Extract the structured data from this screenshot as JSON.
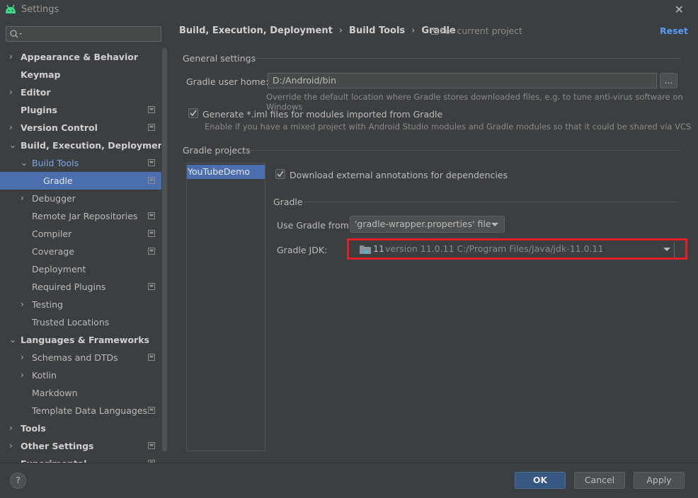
{
  "window": {
    "title": "Settings",
    "close_glyph": "✕",
    "app_icon": "android-icon"
  },
  "search": {
    "placeholder": "",
    "icon": "search-icon"
  },
  "sidebar": {
    "items": [
      {
        "label": "Appearance & Behavior",
        "level": 0,
        "chevron": "›",
        "bold": true,
        "project": false
      },
      {
        "label": "Keymap",
        "level": 0,
        "chevron": "",
        "bold": true,
        "project": false
      },
      {
        "label": "Editor",
        "level": 0,
        "chevron": "›",
        "bold": true,
        "project": false
      },
      {
        "label": "Plugins",
        "level": 0,
        "chevron": "",
        "bold": true,
        "project": true
      },
      {
        "label": "Version Control",
        "level": 0,
        "chevron": "›",
        "bold": true,
        "project": true
      },
      {
        "label": "Build, Execution, Deployment",
        "level": 0,
        "chevron": "⌄",
        "bold": true,
        "project": false
      },
      {
        "label": "Build Tools",
        "level": 1,
        "chevron": "⌄",
        "bold": false,
        "project": true
      },
      {
        "label": "Gradle",
        "level": 2,
        "chevron": "",
        "bold": false,
        "project": true
      },
      {
        "label": "Debugger",
        "level": 1,
        "chevron": "›",
        "bold": false,
        "project": false
      },
      {
        "label": "Remote Jar Repositories",
        "level": 1,
        "chevron": "",
        "bold": false,
        "project": true
      },
      {
        "label": "Compiler",
        "level": 1,
        "chevron": "",
        "bold": false,
        "project": true
      },
      {
        "label": "Coverage",
        "level": 1,
        "chevron": "",
        "bold": false,
        "project": true
      },
      {
        "label": "Deployment",
        "level": 1,
        "chevron": "",
        "bold": false,
        "project": false
      },
      {
        "label": "Required Plugins",
        "level": 1,
        "chevron": "",
        "bold": false,
        "project": true
      },
      {
        "label": "Testing",
        "level": 1,
        "chevron": "›",
        "bold": false,
        "project": false
      },
      {
        "label": "Trusted Locations",
        "level": 1,
        "chevron": "",
        "bold": false,
        "project": false
      },
      {
        "label": "Languages & Frameworks",
        "level": 0,
        "chevron": "⌄",
        "bold": true,
        "project": false
      },
      {
        "label": "Schemas and DTDs",
        "level": 1,
        "chevron": "›",
        "bold": false,
        "project": true
      },
      {
        "label": "Kotlin",
        "level": 1,
        "chevron": "›",
        "bold": false,
        "project": false
      },
      {
        "label": "Markdown",
        "level": 1,
        "chevron": "",
        "bold": false,
        "project": false
      },
      {
        "label": "Template Data Languages",
        "level": 1,
        "chevron": "",
        "bold": false,
        "project": true
      },
      {
        "label": "Tools",
        "level": 0,
        "chevron": "›",
        "bold": true,
        "project": false
      },
      {
        "label": "Other Settings",
        "level": 0,
        "chevron": "›",
        "bold": true,
        "project": true
      },
      {
        "label": "Experimental",
        "level": 0,
        "chevron": "",
        "bold": true,
        "project": true
      }
    ],
    "selected_index": 7
  },
  "breadcrumb": {
    "parts": [
      "Build, Execution, Deployment",
      "Build Tools",
      "Gradle"
    ],
    "separator": "›",
    "for_project": "For current project",
    "reset": "Reset"
  },
  "general": {
    "section_title": "General settings",
    "gradle_home_label": "Gradle user home:",
    "gradle_home_value": "D:/Android/bin",
    "browse_label": "...",
    "gradle_home_hint": "Override the default location where Gradle stores downloaded files, e.g. to tune anti-virus software on Windows",
    "iml_label": "Generate *.iml files for modules imported from Gradle",
    "iml_checked": true,
    "iml_hint": "Enable if you have a mixed project with Android Studio modules and Gradle modules so that it could be shared via VCS"
  },
  "projects": {
    "section_title": "Gradle projects",
    "list": [
      "YouTubeDemo"
    ],
    "download_annotations_label": "Download external annotations for dependencies",
    "download_annotations_checked": true,
    "gradle_subsection": "Gradle",
    "use_gradle_from_label": "Use Gradle from:",
    "use_gradle_from_value": "'gradle-wrapper.properties' file",
    "gradle_jdk_label": "Gradle JDK:",
    "gradle_jdk_version": "11",
    "gradle_jdk_detail": "version 11.0.11 C:/Program Files/Java/jdk-11.0.11"
  },
  "footer": {
    "help": "?",
    "ok": "OK",
    "cancel": "Cancel",
    "apply": "Apply"
  },
  "colors": {
    "accent": "#4b6eaf",
    "primary_button": "#365880",
    "link": "#589df6",
    "highlight_box": "#e31e24"
  }
}
